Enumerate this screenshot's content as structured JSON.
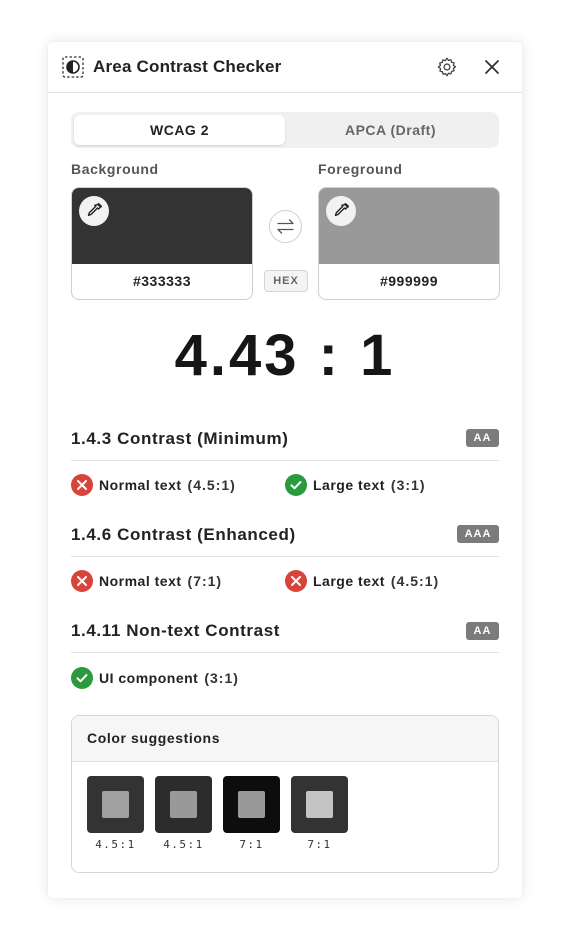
{
  "header": {
    "title": "Area Contrast Checker",
    "app_icon": "contrast-icon",
    "settings_icon": "gear-icon",
    "close_icon": "close-icon"
  },
  "tabs": [
    {
      "label": "WCAG 2",
      "active": true
    },
    {
      "label": "APCA (Draft)",
      "active": false
    }
  ],
  "background": {
    "label": "Background",
    "hex": "#333333",
    "color": "#333333"
  },
  "foreground": {
    "label": "Foreground",
    "hex": "#999999",
    "color": "#999999"
  },
  "format_badge": "HEX",
  "ratio": "4.43 : 1",
  "criteria": [
    {
      "title": "1.4.3 Contrast (Minimum)",
      "level": "AA",
      "results": [
        {
          "label": "Normal text",
          "ratio": "(4.5:1)",
          "pass": false
        },
        {
          "label": "Large text",
          "ratio": "(3:1)",
          "pass": true
        }
      ]
    },
    {
      "title": "1.4.6 Contrast (Enhanced)",
      "level": "AAA",
      "results": [
        {
          "label": "Normal text",
          "ratio": "(7:1)",
          "pass": false
        },
        {
          "label": "Large text",
          "ratio": "(4.5:1)",
          "pass": false
        }
      ]
    },
    {
      "title": "1.4.11 Non-text Contrast",
      "level": "AA",
      "results": [
        {
          "label": "UI component",
          "ratio": "(3:1)",
          "pass": true
        }
      ]
    }
  ],
  "suggestions": {
    "title": "Color suggestions",
    "items": [
      {
        "ratio": "4.5:1",
        "bg": "#333333",
        "fg": "#a0a0a0"
      },
      {
        "ratio": "4.5:1",
        "bg": "#2c2c2c",
        "fg": "#999999"
      },
      {
        "ratio": "7:1",
        "bg": "#0d0d0d",
        "fg": "#999999"
      },
      {
        "ratio": "7:1",
        "bg": "#333333",
        "fg": "#c4c4c4"
      }
    ]
  },
  "colors": {
    "pass": "#2b9a3e",
    "fail": "#d6443a",
    "level_badge": "#7b7b7b"
  }
}
